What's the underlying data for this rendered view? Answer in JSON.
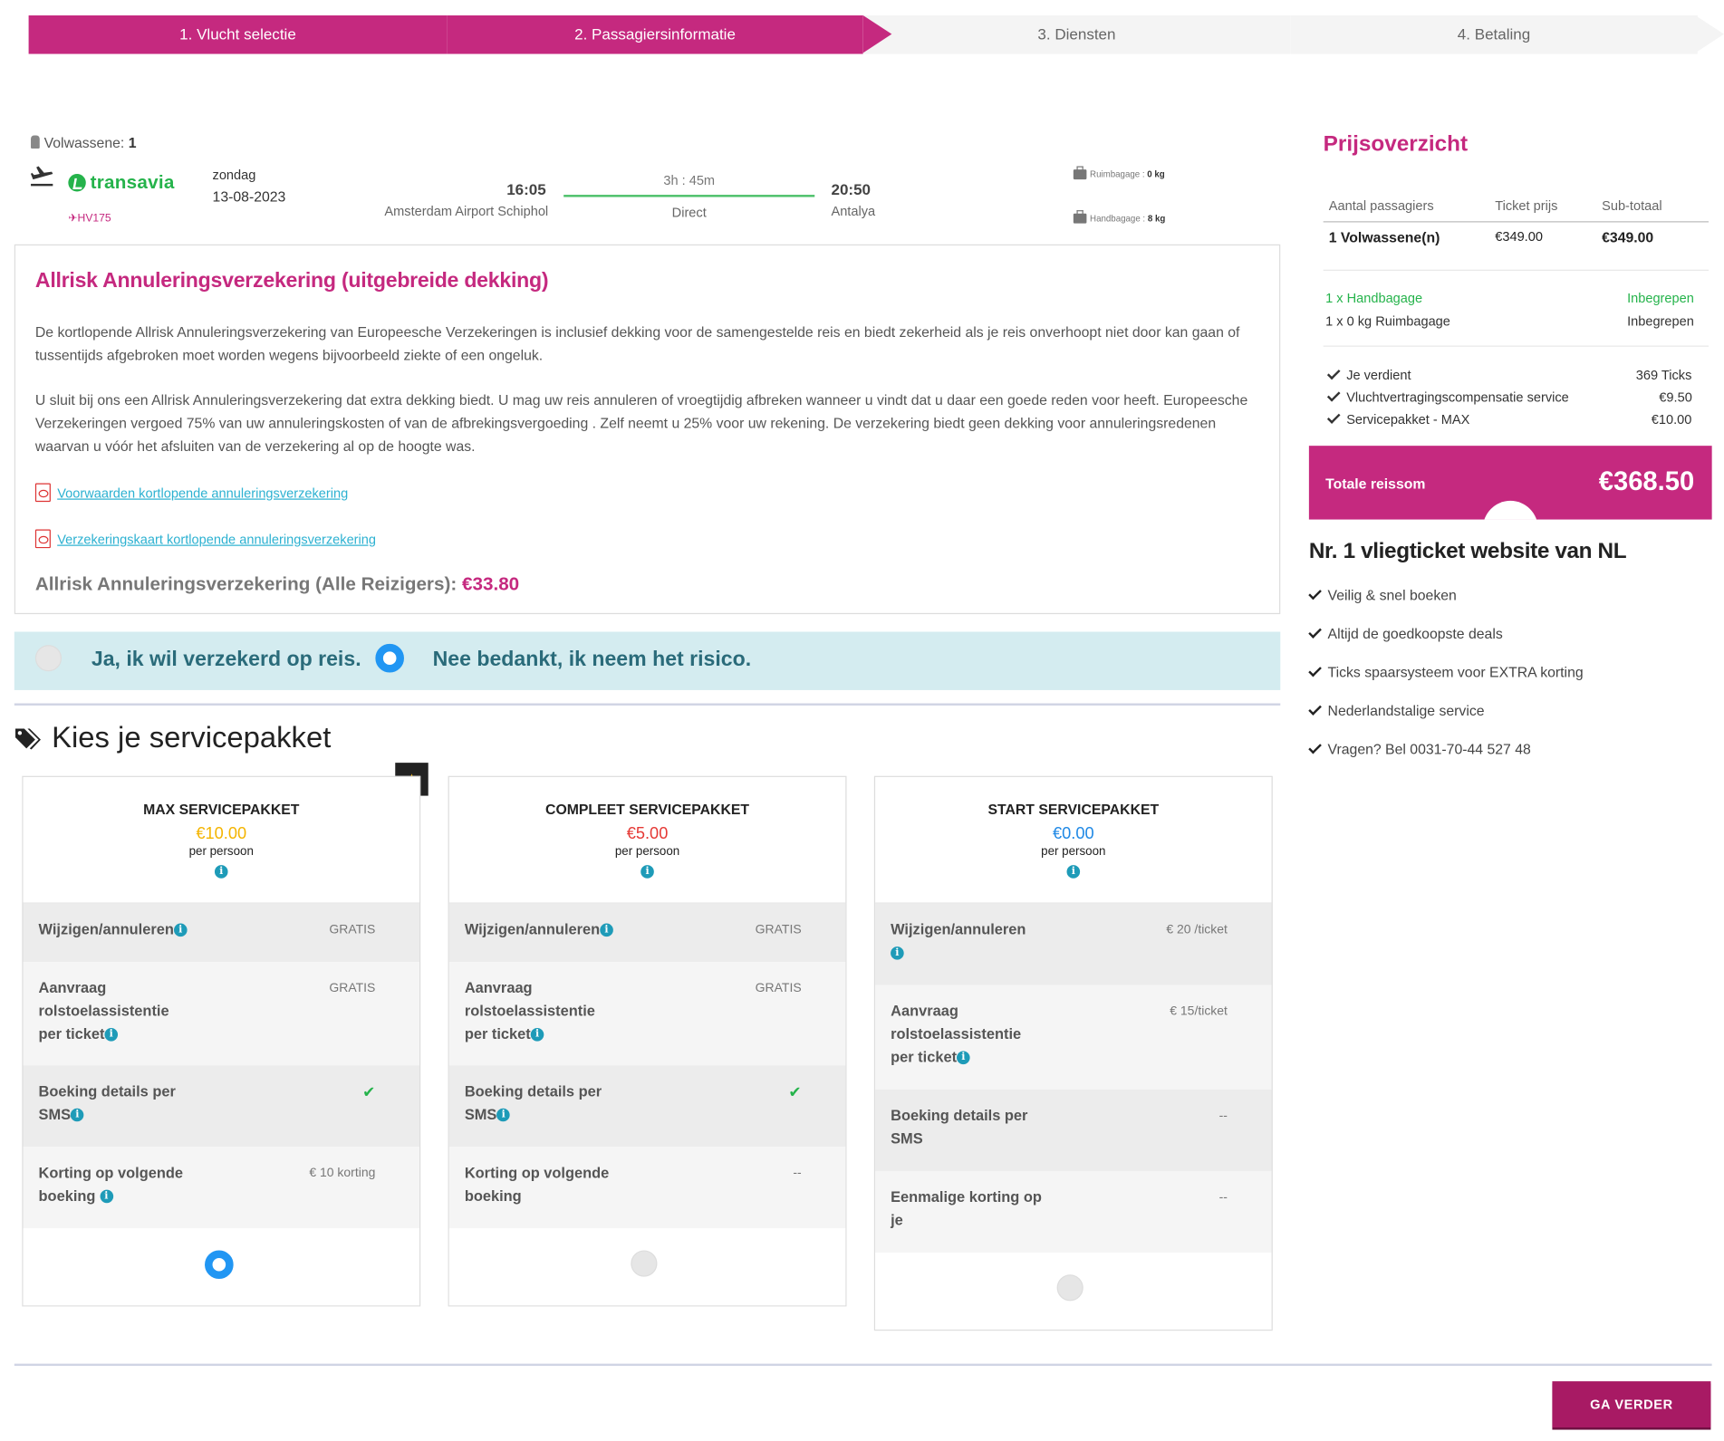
{
  "steps": [
    {
      "label": "1. Vlucht selectie",
      "active": true
    },
    {
      "label": "2. Passagiersinformatie",
      "active": true
    },
    {
      "label": "3. Diensten",
      "active": false
    },
    {
      "label": "4. Betaling",
      "active": false
    }
  ],
  "flight": {
    "pax_label": "Volwassene:",
    "pax_count": "1",
    "airline": "transavia",
    "flight_no": "HV175",
    "day": "zondag",
    "date": "13-08-2023",
    "dep_time": "16:05",
    "dep_airport": "Amsterdam Airport Schiphol",
    "duration": "3h : 45m",
    "stops": "Direct",
    "arr_time": "20:50",
    "arr_airport": "Antalya",
    "hold_bag_label": "Ruimbagage :",
    "hold_bag_value": "0 kg",
    "hand_bag_label": "Handbagage :",
    "hand_bag_value": "8 kg"
  },
  "insurance": {
    "title": "Allrisk Annuleringsverzekering (uitgebreide dekking)",
    "para1": "De kortlopende Allrisk Annuleringsverzekering van Europeesche Verzekeringen is inclusief dekking voor de samengestelde reis en biedt zekerheid als je reis onverhoopt niet door kan gaan of tussentijds afgebroken moet worden wegens bijvoorbeeld ziekte of een ongeluk.",
    "para2": "U sluit bij ons een Allrisk Annuleringsverzekering dat extra dekking biedt. U mag uw reis annuleren of vroegtijdig afbreken wanneer u vindt dat u daar een goede reden voor heeft. Europeesche Verzekeringen vergoed 75% van uw annuleringskosten of van de afbrekingsvergoeding . Zelf neemt u 25% voor uw rekening. De verzekering biedt geen dekking voor annuleringsredenen waarvan u vóór het afsluiten van de verzekering al op de hoogte was.",
    "link1": "Voorwaarden kortlopende annuleringsverzekering",
    "link2": "Verzekeringskaart kortlopende annuleringsverzekering",
    "price_label": "Allrisk Annuleringsverzekering (Alle Reizigers):",
    "price_value": "€33.80",
    "option_yes": "Ja, ik wil verzekerd op reis.",
    "option_no": "Nee bedankt, ik neem het risico.",
    "selected": "no"
  },
  "services": {
    "title": "Kies je servicepakket",
    "packages": [
      {
        "name": "MAX SERVICEPAKKET",
        "price": "€10.00",
        "price_color": "#f4b400",
        "per": "per persoon",
        "selected": true,
        "rows": [
          {
            "label": "Wijzigen/annuleren",
            "value": "GRATIS"
          },
          {
            "label": "Aanvraag rolstoelassistentie per ticket",
            "value": "GRATIS"
          },
          {
            "label": "Boeking details per SMS",
            "value": "✔"
          },
          {
            "label": "Korting op volgende boeking",
            "value": "€ 10 korting"
          }
        ]
      },
      {
        "name": "COMPLEET SERVICEPAKKET",
        "price": "€5.00",
        "price_color": "#e53935",
        "per": "per persoon",
        "selected": false,
        "rows": [
          {
            "label": "Wijzigen/annuleren",
            "value": "GRATIS"
          },
          {
            "label": "Aanvraag rolstoelassistentie per ticket",
            "value": "GRATIS"
          },
          {
            "label": "Boeking details per SMS",
            "value": "✔"
          },
          {
            "label": "Korting op volgende boeking",
            "value": "--"
          }
        ]
      },
      {
        "name": "START SERVICEPAKKET",
        "price": "€0.00",
        "price_color": "#1e88e5",
        "per": "per persoon",
        "selected": false,
        "rows": [
          {
            "label": "Wijzigen/annuleren",
            "value": "€ 20 /ticket"
          },
          {
            "label": "Aanvraag rolstoelassistentie per ticket",
            "value": "€ 15/ticket"
          },
          {
            "label": "Boeking details per SMS",
            "value": "--"
          },
          {
            "label": "Eenmalige korting op je",
            "value": "--"
          }
        ]
      }
    ]
  },
  "summary": {
    "title": "Prijsoverzicht",
    "col_pax": "Aantal passagiers",
    "col_ticket": "Ticket prijs",
    "col_sub": "Sub-totaal",
    "pax": "1 Volwassene(n)",
    "ticket_price": "€349.00",
    "subtotal": "€349.00",
    "hand_bag": "1 x Handbagage",
    "hand_bag_val": "Inbegrepen",
    "hold_bag": "1 x 0 kg Ruimbagage",
    "hold_bag_val": "Inbegrepen",
    "earn_label": "Je verdient",
    "earn_val": "369 Ticks",
    "delay_label": "Vluchtvertragingscompensatie service",
    "delay_val": "€9.50",
    "pack_label": "Servicepakket - MAX",
    "pack_val": "€10.00",
    "total_label": "Totale reissom",
    "total_val": "€368.50"
  },
  "usp": {
    "title": "Nr. 1 vliegticket website van NL",
    "items": [
      "Veilig & snel boeken",
      "Altijd de goedkoopste deals",
      "Ticks spaarsysteem voor EXTRA korting",
      "Nederlandstalige service",
      "Vragen? Bel 0031-70-44 527 48"
    ]
  },
  "next_button": "GA VERDER"
}
